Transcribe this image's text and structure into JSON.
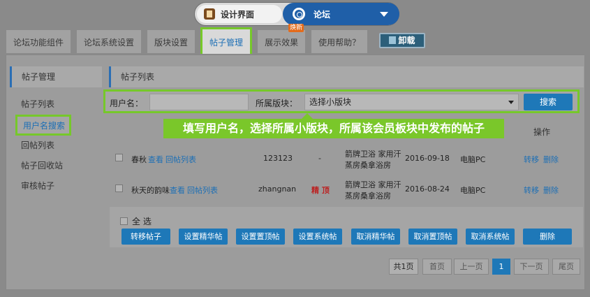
{
  "switcher": {
    "left_label": "设计界面",
    "right_label": "论坛"
  },
  "tabs": [
    {
      "label": "论坛功能组件",
      "active": false
    },
    {
      "label": "论坛系统设置",
      "active": false
    },
    {
      "label": "版块设置",
      "active": false
    },
    {
      "label": "帖子管理",
      "active": true
    },
    {
      "label": "展示效果",
      "active": false,
      "badge": "焕新"
    },
    {
      "label": "使用帮助？",
      "active": false
    }
  ],
  "uninstall_label": "卸载",
  "sidebar": {
    "title": "帖子管理",
    "items": [
      "帖子列表",
      "用户名搜索",
      "回帖列表",
      "帖子回收站",
      "审核帖子"
    ]
  },
  "content": {
    "title": "帖子列表",
    "search": {
      "username_label": "用户名：",
      "username_value": "",
      "board_label": "所属版块：",
      "board_selected": "选择小版块",
      "search_button": "搜索"
    },
    "tooltip": "填写用户名，选择所属小版块，所属该会员板块中发布的帖子",
    "ops_header": "操作",
    "rows": [
      {
        "title": "春秋",
        "view": "查看",
        "replies": "回帖列表",
        "user": "123123",
        "flag": "-",
        "board_line1": "箭牌卫浴 家用汗",
        "board_line2": "蒸房桑拿浴房",
        "date": "2016-09-18",
        "device": "电脑PC",
        "move": "转移",
        "delete": "删除"
      },
      {
        "title": "秋天的韵味",
        "view": "查看",
        "replies": "回帖列表",
        "user": "zhangnan",
        "flag": "精 顶",
        "board_line1": "箭牌卫浴 家用汗",
        "board_line2": "蒸房桑拿浴房",
        "date": "2016-08-24",
        "device": "电脑PC",
        "move": "转移",
        "delete": "删除"
      }
    ],
    "select_all": "全 选",
    "actions": [
      "转移帖子",
      "设置精华帖",
      "设置置顶帖",
      "设置系统帖",
      "取消精华帖",
      "取消置顶帖",
      "取消系统帖",
      "删除"
    ],
    "pager": {
      "total": "共1页",
      "first": "首页",
      "prev": "上一页",
      "current": "1",
      "next": "下一页",
      "last": "尾页"
    }
  },
  "colors": {
    "accent": "#1e78b8",
    "highlight": "#76c82a",
    "tooltip": "#7ac72a"
  }
}
